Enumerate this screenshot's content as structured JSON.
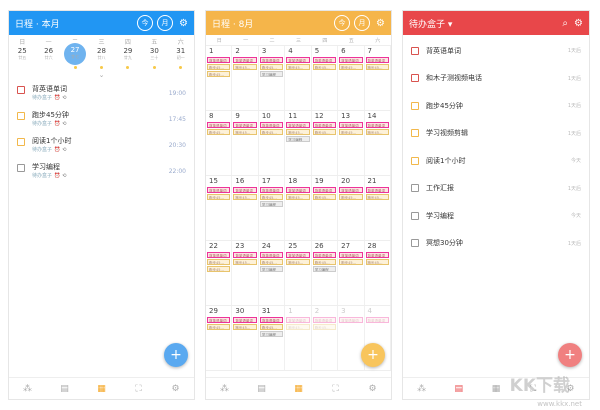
{
  "colors": {
    "blue": "#2196f3",
    "orange": "#f5b54a",
    "red": "#e8474a",
    "fab_blue": "#5aa9f0",
    "fab_orange": "#f8c55d",
    "fab_red": "#f08080",
    "red_box": "#d9534f",
    "yellow_box": "#f2b84b",
    "gray_box": "#999999"
  },
  "weekdays": [
    "日",
    "一",
    "二",
    "三",
    "四",
    "五",
    "六"
  ],
  "week_view": {
    "header_title": "日程 · 本月",
    "btn_today": "今",
    "btn_week": "月",
    "dates": [
      {
        "day": "25",
        "sub": "廿五",
        "dot": false,
        "selected": false
      },
      {
        "day": "26",
        "sub": "廿六",
        "dot": false,
        "selected": false
      },
      {
        "day": "27",
        "sub": "廿七",
        "dot": true,
        "selected": true
      },
      {
        "day": "28",
        "sub": "廿八",
        "dot": true,
        "selected": false
      },
      {
        "day": "29",
        "sub": "廿九",
        "dot": true,
        "selected": false
      },
      {
        "day": "30",
        "sub": "三十",
        "dot": true,
        "selected": false
      },
      {
        "day": "31",
        "sub": "初一",
        "dot": true,
        "selected": false
      }
    ],
    "tasks": [
      {
        "name": "背英语单词",
        "sub": "待办盒子",
        "time": "19:00",
        "color": "red"
      },
      {
        "name": "跑步45分钟",
        "sub": "待办盒子",
        "time": "17:45",
        "color": "yellow"
      },
      {
        "name": "阅读1个小时",
        "sub": "待办盒子",
        "time": "20:30",
        "color": "yellow"
      },
      {
        "name": "学习编程",
        "sub": "待办盒子",
        "time": "22:00",
        "color": "gray"
      }
    ],
    "fab": "+"
  },
  "month_view": {
    "header_title": "日程 · 8月",
    "btn_today": "今",
    "btn_month": "月",
    "rows": [
      [
        {
          "n": "1",
          "c": [
            "r",
            "y",
            "y"
          ]
        },
        {
          "n": "2",
          "c": [
            "r",
            "y"
          ]
        },
        {
          "n": "3",
          "c": [
            "r",
            "y",
            "g"
          ]
        },
        {
          "n": "4",
          "c": [
            "r",
            "y"
          ]
        },
        {
          "n": "5",
          "c": [
            "r",
            "y"
          ]
        },
        {
          "n": "6",
          "c": [
            "r",
            "y"
          ]
        },
        {
          "n": "7",
          "c": [
            "r",
            "y"
          ]
        }
      ],
      [
        {
          "n": "8",
          "c": [
            "r",
            "y"
          ]
        },
        {
          "n": "9",
          "c": [
            "r",
            "y"
          ]
        },
        {
          "n": "10",
          "c": [
            "r",
            "y"
          ]
        },
        {
          "n": "11",
          "c": [
            "r",
            "y",
            "g"
          ]
        },
        {
          "n": "12",
          "c": [
            "r",
            "y"
          ]
        },
        {
          "n": "13",
          "c": [
            "r",
            "y"
          ]
        },
        {
          "n": "14",
          "c": [
            "r",
            "y"
          ]
        }
      ],
      [
        {
          "n": "15",
          "c": [
            "r",
            "y"
          ]
        },
        {
          "n": "16",
          "c": [
            "r",
            "y"
          ]
        },
        {
          "n": "17",
          "c": [
            "r",
            "y",
            "g"
          ]
        },
        {
          "n": "18",
          "c": [
            "r",
            "y"
          ]
        },
        {
          "n": "19",
          "c": [
            "r",
            "y"
          ]
        },
        {
          "n": "20",
          "c": [
            "r",
            "y"
          ]
        },
        {
          "n": "21",
          "c": [
            "r",
            "y"
          ]
        }
      ],
      [
        {
          "n": "22",
          "c": [
            "r",
            "y",
            "y"
          ]
        },
        {
          "n": "23",
          "c": [
            "r",
            "y"
          ]
        },
        {
          "n": "24",
          "c": [
            "r",
            "y",
            "g"
          ]
        },
        {
          "n": "25",
          "c": [
            "r",
            "y"
          ]
        },
        {
          "n": "26",
          "c": [
            "r",
            "y",
            "g"
          ]
        },
        {
          "n": "27",
          "c": [
            "r",
            "y"
          ]
        },
        {
          "n": "28",
          "c": [
            "r",
            "y"
          ]
        }
      ],
      [
        {
          "n": "29",
          "c": [
            "r",
            "y"
          ]
        },
        {
          "n": "30",
          "c": [
            "r",
            "y"
          ]
        },
        {
          "n": "31",
          "c": [
            "r",
            "y",
            "g"
          ]
        },
        {
          "n": "1",
          "c": [
            "r",
            "y"
          ],
          "fade": true
        },
        {
          "n": "2",
          "c": [
            "r",
            "y"
          ],
          "fade": true
        },
        {
          "n": "3",
          "c": [
            "r"
          ],
          "fade": true
        },
        {
          "n": "4",
          "c": [
            "r"
          ],
          "fade": true
        }
      ]
    ],
    "chip_text": {
      "r": "背英语单词",
      "y": "跑步45…",
      "g": "学习编程"
    },
    "fab": "+"
  },
  "inbox_view": {
    "header_title": "待办盒子",
    "items": [
      {
        "text": "背英语单词",
        "right": "1天后",
        "color": "red"
      },
      {
        "text": "和木子测视频电话",
        "right": "1天后",
        "color": "red"
      },
      {
        "text": "跑步45分钟",
        "right": "1天后",
        "color": "yellow"
      },
      {
        "text": "学习视频剪辑",
        "right": "1天后",
        "color": "yellow"
      },
      {
        "text": "阅读1个小时",
        "right": "今天",
        "color": "yellow"
      },
      {
        "text": "工作汇报",
        "right": "1天后",
        "color": "gray"
      },
      {
        "text": "学习编程",
        "right": "今天",
        "color": "gray"
      },
      {
        "text": "冥想30分钟",
        "right": "1天后",
        "color": "gray"
      }
    ],
    "fab": "+"
  },
  "nav_icons": [
    "share-icon",
    "clipboard-icon",
    "calendar-icon",
    "focus-icon",
    "gear-icon"
  ],
  "nav_glyphs": [
    "⁂",
    "▤",
    "▦",
    "⛶",
    "⚙"
  ],
  "watermark": {
    "logo": "KK下载",
    "url": "www.kkx.net"
  }
}
